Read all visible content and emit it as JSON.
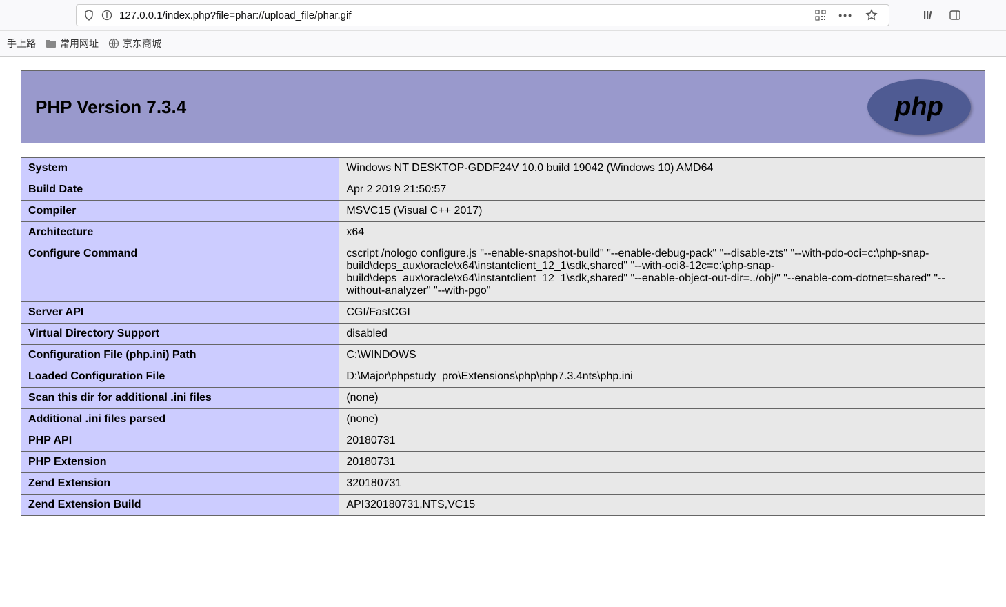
{
  "browser": {
    "url": "127.0.0.1/index.php?file=phar://upload_file/phar.gif"
  },
  "bookmarks": {
    "b1": "手上路",
    "b2": "常用网址",
    "b3": "京东商城"
  },
  "header_title": "PHP Version 7.3.4",
  "php_logo_text": "php",
  "rows": [
    {
      "k": "System",
      "v": "Windows NT DESKTOP-GDDF24V 10.0 build 19042 (Windows 10) AMD64"
    },
    {
      "k": "Build Date",
      "v": "Apr 2 2019 21:50:57"
    },
    {
      "k": "Compiler",
      "v": "MSVC15 (Visual C++ 2017)"
    },
    {
      "k": "Architecture",
      "v": "x64"
    },
    {
      "k": "Configure Command",
      "v": "cscript /nologo configure.js \"--enable-snapshot-build\" \"--enable-debug-pack\" \"--disable-zts\" \"--with-pdo-oci=c:\\php-snap-build\\deps_aux\\oracle\\x64\\instantclient_12_1\\sdk,shared\" \"--with-oci8-12c=c:\\php-snap-build\\deps_aux\\oracle\\x64\\instantclient_12_1\\sdk,shared\" \"--enable-object-out-dir=../obj/\" \"--enable-com-dotnet=shared\" \"--without-analyzer\" \"--with-pgo\""
    },
    {
      "k": "Server API",
      "v": "CGI/FastCGI"
    },
    {
      "k": "Virtual Directory Support",
      "v": "disabled"
    },
    {
      "k": "Configuration File (php.ini) Path",
      "v": "C:\\WINDOWS"
    },
    {
      "k": "Loaded Configuration File",
      "v": "D:\\Major\\phpstudy_pro\\Extensions\\php\\php7.3.4nts\\php.ini"
    },
    {
      "k": "Scan this dir for additional .ini files",
      "v": "(none)"
    },
    {
      "k": "Additional .ini files parsed",
      "v": "(none)"
    },
    {
      "k": "PHP API",
      "v": "20180731"
    },
    {
      "k": "PHP Extension",
      "v": "20180731"
    },
    {
      "k": "Zend Extension",
      "v": "320180731"
    },
    {
      "k": "Zend Extension Build",
      "v": "API320180731,NTS,VC15"
    }
  ]
}
